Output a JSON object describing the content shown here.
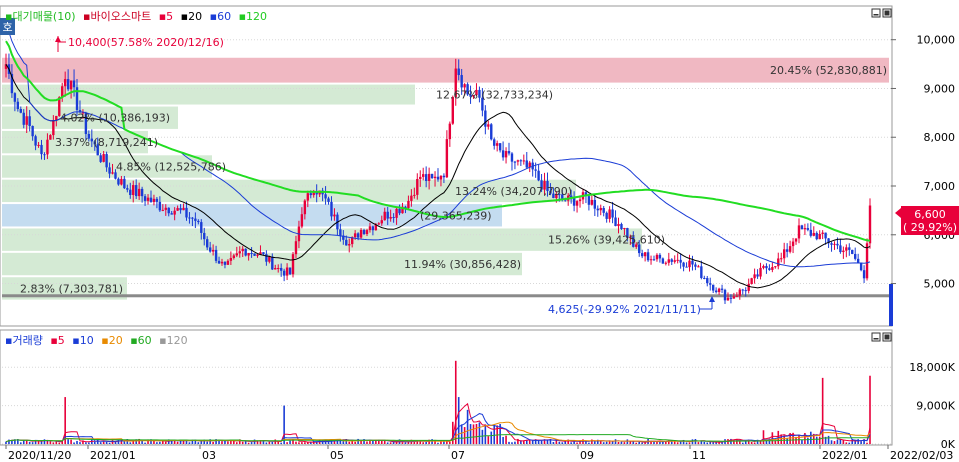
{
  "price_panel": {
    "tab_label": "호",
    "legend_prefix": "▪대기매물(10)",
    "legend_stock": "▪바이오스마트",
    "legend_ma": [
      {
        "label": "▪5",
        "color": "#e8003a"
      },
      {
        "label": "▪20",
        "color": "#000000"
      },
      {
        "label": "▪60",
        "color": "#1a3cd6"
      },
      {
        "label": "▪120",
        "color": "#22dd22"
      }
    ],
    "current_price": "6,600",
    "current_change": "( 29.92%)",
    "high_annotation": "10,400(57.58% 2020/12/16)",
    "low_annotation": "4,625(-29.92% 2021/11/11)"
  },
  "volume_panel": {
    "legend_prefix": "▪거래량",
    "legend_ma": [
      {
        "label": "▪5",
        "color": "#e8003a"
      },
      {
        "label": "▪10",
        "color": "#1a3cd6"
      },
      {
        "label": "▪20",
        "color": "#e88a00"
      },
      {
        "label": "▪60",
        "color": "#22aa22"
      },
      {
        "label": "▪120",
        "color": "#999999"
      }
    ]
  },
  "chart_data": {
    "type": "candlestick",
    "price_axis": {
      "ticks": [
        10000,
        9000,
        8000,
        7000,
        6000,
        5000
      ],
      "tick_labels": [
        "10,000",
        "9,000",
        "8,000",
        "7,000",
        "6,000",
        "5,000"
      ],
      "ylim": [
        4150,
        10650
      ]
    },
    "volume_axis": {
      "ticks": [
        18000,
        9000,
        0
      ],
      "tick_labels": [
        "18,000K",
        "9,000K",
        "0K"
      ],
      "ylim": [
        0,
        22500
      ]
    },
    "x_axis_labels": [
      "2020/11/20",
      "2021/01",
      "03",
      "05",
      "07",
      "09",
      "11",
      "2022/01",
      "2022/02/03"
    ],
    "volume_profile": [
      {
        "from": 9100,
        "to": 9650,
        "label": "20.45% (52,830,881)",
        "color": "#f0b8c2"
      },
      {
        "from": 8650,
        "to": 9100,
        "label": "12.67% (32,733,234)",
        "color": "#d4ead4"
      },
      {
        "from": 8150,
        "to": 8650,
        "label": "4.02% (10,386,193)",
        "color": "#d4ead4"
      },
      {
        "from": 7650,
        "to": 8150,
        "label": "3.37% (8,719,241)",
        "color": "#d4ead4"
      },
      {
        "from": 7150,
        "to": 7650,
        "label": "4.85% (12,525,786)",
        "color": "#d4ead4"
      },
      {
        "from": 6650,
        "to": 7150,
        "label": "13.24% (34,207,790)",
        "color": "#d4ead4"
      },
      {
        "from": 6150,
        "to": 6650,
        "label": "(29,365,239)",
        "color": "#c4dcf0"
      },
      {
        "from": 5650,
        "to": 6150,
        "label": "15.26% (39,425,610)",
        "color": "#d4ead4"
      },
      {
        "from": 5150,
        "to": 5650,
        "label": "11.94% (30,856,428)",
        "color": "#d4ead4"
      },
      {
        "from": 4650,
        "to": 5150,
        "label": "2.83% (7,303,781)",
        "color": "#d4ead4"
      }
    ],
    "price_keypoints": [
      [
        0,
        9500
      ],
      [
        4,
        8600
      ],
      [
        8,
        8200
      ],
      [
        12,
        7600
      ],
      [
        16,
        8300
      ],
      [
        20,
        9300
      ],
      [
        24,
        8700
      ],
      [
        28,
        8000
      ],
      [
        34,
        7400
      ],
      [
        40,
        7000
      ],
      [
        46,
        6800
      ],
      [
        52,
        6600
      ],
      [
        58,
        6500
      ],
      [
        64,
        6300
      ],
      [
        68,
        5800
      ],
      [
        74,
        5300
      ],
      [
        80,
        5700
      ],
      [
        86,
        5600
      ],
      [
        92,
        5300
      ],
      [
        96,
        5200
      ],
      [
        100,
        6500
      ],
      [
        104,
        7000
      ],
      [
        108,
        6700
      ],
      [
        112,
        6200
      ],
      [
        116,
        5800
      ],
      [
        120,
        6100
      ],
      [
        124,
        6200
      ],
      [
        128,
        6400
      ],
      [
        132,
        6500
      ],
      [
        136,
        6700
      ],
      [
        140,
        7200
      ],
      [
        144,
        7100
      ],
      [
        148,
        7300
      ],
      [
        152,
        9500
      ],
      [
        156,
        8900
      ],
      [
        160,
        8800
      ],
      [
        164,
        7900
      ],
      [
        168,
        7600
      ],
      [
        172,
        7500
      ],
      [
        178,
        7300
      ],
      [
        184,
        6800
      ],
      [
        190,
        6700
      ],
      [
        196,
        6750
      ],
      [
        202,
        6500
      ],
      [
        208,
        6200
      ],
      [
        214,
        5600
      ],
      [
        220,
        5500
      ],
      [
        226,
        5500
      ],
      [
        232,
        5400
      ],
      [
        238,
        5000
      ],
      [
        244,
        4700
      ],
      [
        250,
        4900
      ],
      [
        256,
        5300
      ],
      [
        262,
        5500
      ],
      [
        268,
        6100
      ],
      [
        274,
        6000
      ],
      [
        280,
        5800
      ],
      [
        286,
        5600
      ],
      [
        290,
        5200
      ],
      [
        292,
        6600
      ]
    ],
    "current_price": 6600
  }
}
